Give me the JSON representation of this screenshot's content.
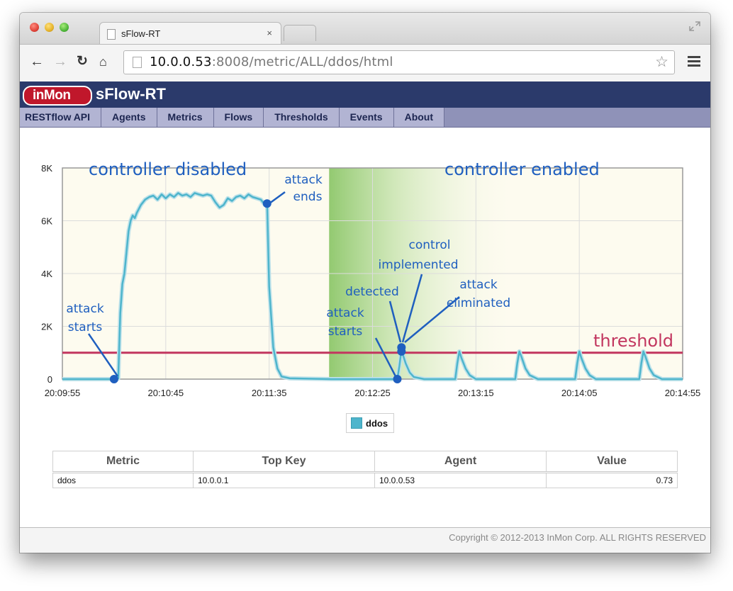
{
  "browser": {
    "tab_title": "sFlow-RT",
    "tab_close": "×",
    "url_host": "10.0.0.53",
    "url_path": ":8008/metric/ALL/ddos/html"
  },
  "app": {
    "logo_text": "inMon",
    "title": "sFlow-RT"
  },
  "nav": {
    "items": [
      {
        "label": "RESTflow API"
      },
      {
        "label": "Agents"
      },
      {
        "label": "Metrics"
      },
      {
        "label": "Flows"
      },
      {
        "label": "Thresholds"
      },
      {
        "label": "Events"
      },
      {
        "label": "About"
      }
    ]
  },
  "chart_data": {
    "type": "line",
    "series": [
      {
        "name": "ddos",
        "color": "#4eb5cc"
      }
    ],
    "x_ticks": [
      "20:09:55",
      "20:10:45",
      "20:11:35",
      "20:12:25",
      "20:13:15",
      "20:14:05",
      "20:14:55"
    ],
    "y_ticks": [
      "0",
      "2K",
      "4K",
      "6K",
      "8K"
    ],
    "ylim": [
      0,
      8000
    ],
    "x_range_seconds": [
      0,
      300
    ],
    "points": [
      [
        0,
        0
      ],
      [
        25,
        0
      ],
      [
        27,
        30
      ],
      [
        28,
        2500
      ],
      [
        29,
        3600
      ],
      [
        30,
        4000
      ],
      [
        31,
        4800
      ],
      [
        32,
        5600
      ],
      [
        33,
        6000
      ],
      [
        34,
        6200
      ],
      [
        35,
        6100
      ],
      [
        36,
        6300
      ],
      [
        38,
        6600
      ],
      [
        40,
        6800
      ],
      [
        42,
        6900
      ],
      [
        44,
        6950
      ],
      [
        46,
        6800
      ],
      [
        48,
        7000
      ],
      [
        50,
        6850
      ],
      [
        52,
        7000
      ],
      [
        54,
        6900
      ],
      [
        56,
        7050
      ],
      [
        58,
        6950
      ],
      [
        60,
        7000
      ],
      [
        62,
        6900
      ],
      [
        64,
        7050
      ],
      [
        66,
        7000
      ],
      [
        68,
        6950
      ],
      [
        70,
        7000
      ],
      [
        72,
        6950
      ],
      [
        74,
        6700
      ],
      [
        76,
        6500
      ],
      [
        78,
        6600
      ],
      [
        80,
        6850
      ],
      [
        82,
        6750
      ],
      [
        84,
        6900
      ],
      [
        86,
        6950
      ],
      [
        88,
        6850
      ],
      [
        90,
        7000
      ],
      [
        92,
        6900
      ],
      [
        94,
        6850
      ],
      [
        96,
        6800
      ],
      [
        98,
        6600
      ],
      [
        99,
        6700
      ],
      [
        100,
        3500
      ],
      [
        102,
        1200
      ],
      [
        104,
        400
      ],
      [
        106,
        100
      ],
      [
        110,
        30
      ],
      [
        130,
        0
      ],
      [
        162,
        0
      ],
      [
        163,
        500
      ],
      [
        164,
        1100
      ],
      [
        166,
        600
      ],
      [
        168,
        250
      ],
      [
        170,
        80
      ],
      [
        175,
        0
      ],
      [
        190,
        0
      ],
      [
        191,
        600
      ],
      [
        192,
        1050
      ],
      [
        193,
        800
      ],
      [
        195,
        400
      ],
      [
        197,
        150
      ],
      [
        200,
        0
      ],
      [
        219,
        0
      ],
      [
        220,
        600
      ],
      [
        221,
        1050
      ],
      [
        222,
        850
      ],
      [
        224,
        400
      ],
      [
        226,
        150
      ],
      [
        230,
        0
      ],
      [
        248,
        0
      ],
      [
        249,
        600
      ],
      [
        250,
        1050
      ],
      [
        251,
        800
      ],
      [
        253,
        400
      ],
      [
        255,
        150
      ],
      [
        258,
        0
      ],
      [
        279,
        0
      ],
      [
        280,
        600
      ],
      [
        281,
        1050
      ],
      [
        282,
        850
      ],
      [
        284,
        400
      ],
      [
        286,
        150
      ],
      [
        290,
        0
      ],
      [
        300,
        0
      ]
    ],
    "threshold": 1000,
    "legend": "ddos",
    "annotations": [
      {
        "text": "controller disabled"
      },
      {
        "text": "controller enabled"
      },
      {
        "text": "attack"
      },
      {
        "text": "ends"
      },
      {
        "text": "attack"
      },
      {
        "text": "starts"
      },
      {
        "text": "attack"
      },
      {
        "text": "starts"
      },
      {
        "text": "detected"
      },
      {
        "text": "control"
      },
      {
        "text": "implemented"
      },
      {
        "text": "attack"
      },
      {
        "text": "eliminated"
      },
      {
        "text": "threshold"
      }
    ]
  },
  "table": {
    "headers": [
      "Metric",
      "Top Key",
      "Agent",
      "Value"
    ],
    "rows": [
      [
        "ddos",
        "10.0.0.1",
        "10.0.0.53",
        "0.73"
      ]
    ]
  },
  "footer": {
    "copyright": "Copyright © 2012-2013 InMon Corp. ALL RIGHTS RESERVED"
  }
}
